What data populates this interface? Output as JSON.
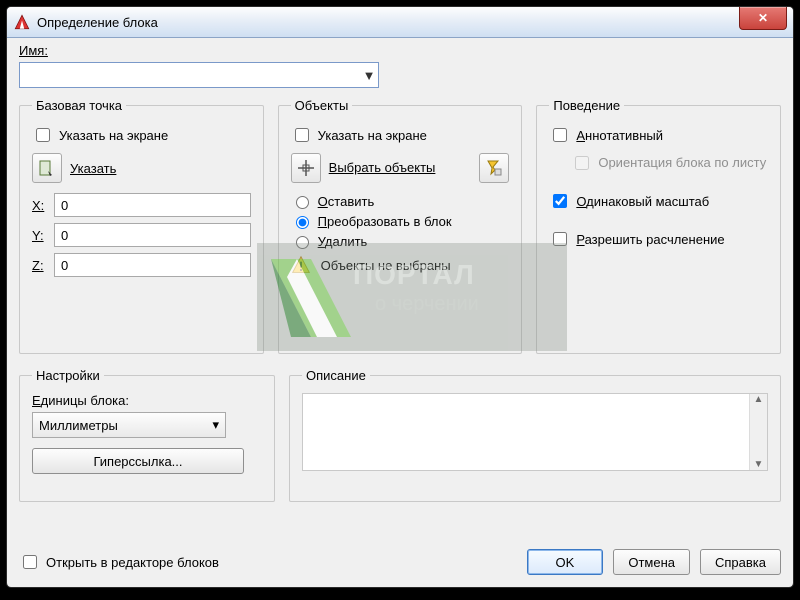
{
  "window": {
    "title": "Определение блока"
  },
  "name": {
    "label": "Имя:",
    "value": ""
  },
  "base": {
    "legend": "Базовая точка",
    "onscreen": "Указать на экране",
    "pick": "Указать",
    "x_label": "X:",
    "x": "0",
    "y_label": "Y:",
    "y": "0",
    "z_label": "Z:",
    "z": "0"
  },
  "objects": {
    "legend": "Объекты",
    "onscreen": "Указать на экране",
    "select": "Выбрать объекты",
    "opt_retain": "Оставить",
    "opt_convert": "Преобразовать в блок",
    "opt_delete": "Удалить",
    "warn": "Объекты не выбраны"
  },
  "behavior": {
    "legend": "Поведение",
    "annotative": "Аннотативный",
    "orient": "Ориентация блока по листу",
    "uniform": "Одинаковый масштаб",
    "explode": "Разрешить расчленение"
  },
  "settings": {
    "legend": "Настройки",
    "units_label": "Единицы блока:",
    "units_value": "Миллиметры",
    "hyperlink": "Гиперссылка..."
  },
  "description": {
    "legend": "Описание",
    "value": ""
  },
  "footer": {
    "open_editor": "Открыть в редакторе блоков",
    "ok": "OK",
    "cancel": "Отмена",
    "help": "Справка"
  },
  "watermark": {
    "line1": "ПОРТАЛ",
    "line2": "о черчении"
  }
}
